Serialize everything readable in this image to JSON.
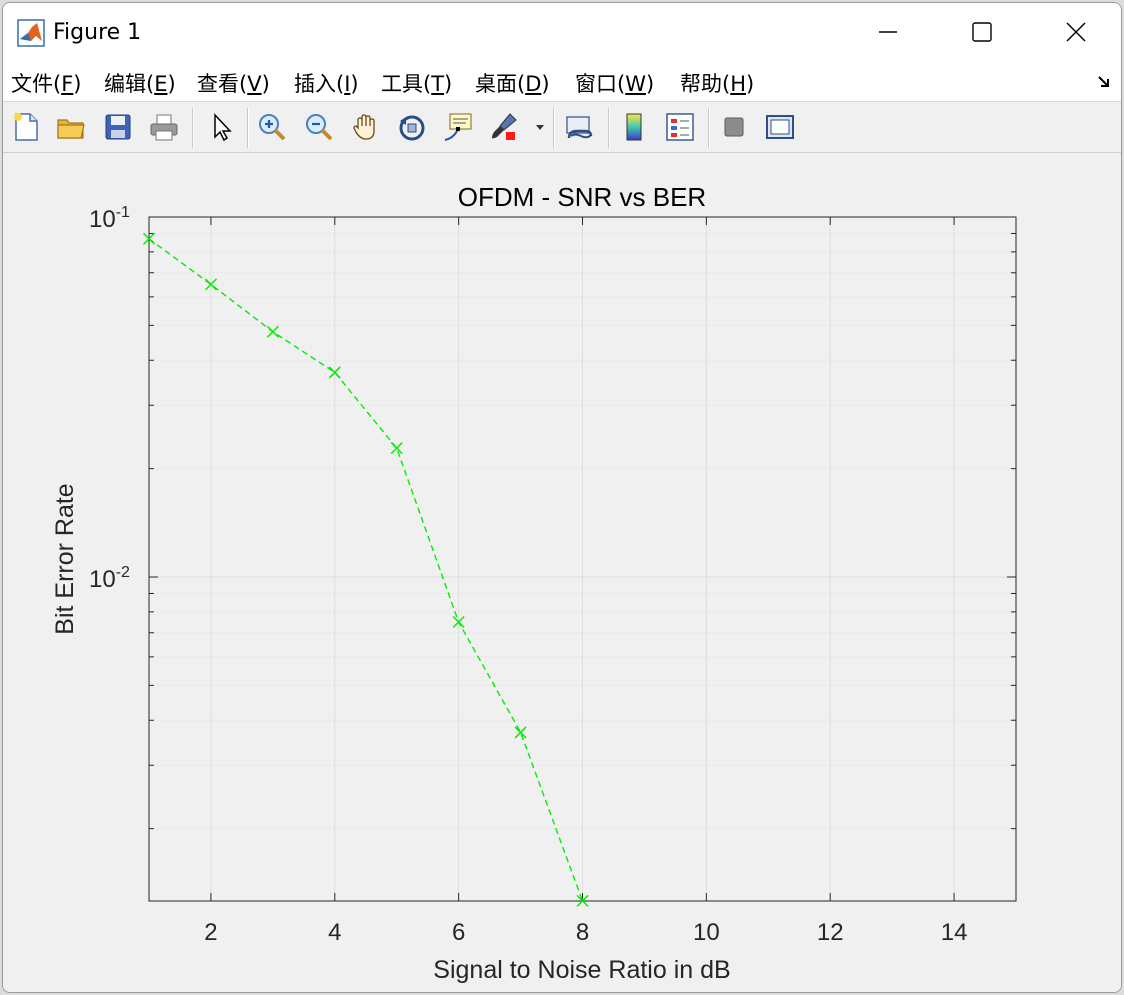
{
  "window": {
    "title": "Figure 1",
    "controls": [
      "minimize",
      "maximize",
      "close"
    ]
  },
  "menu": [
    {
      "label": "文件(",
      "key": "F",
      "tail": ")"
    },
    {
      "label": "编辑(",
      "key": "E",
      "tail": ")"
    },
    {
      "label": "查看(",
      "key": "V",
      "tail": ")"
    },
    {
      "label": "插入(",
      "key": "I",
      "tail": ")"
    },
    {
      "label": "工具(",
      "key": "T",
      "tail": ")"
    },
    {
      "label": "桌面(",
      "key": "D",
      "tail": ")"
    },
    {
      "label": "窗口(",
      "key": "W",
      "tail": ")"
    },
    {
      "label": "帮助(",
      "key": "H",
      "tail": ")"
    }
  ],
  "toolbar": [
    "new-figure",
    "open-file",
    "save",
    "print",
    "edit-plot",
    "zoom-in",
    "zoom-out",
    "pan",
    "rotate-3d",
    "data-cursor",
    "brush",
    "brush-dropdown",
    "link-plot",
    "colorbar",
    "legend",
    "hide-plot-tools",
    "show-plot-tools"
  ],
  "colors": {
    "series": "#00ee00",
    "grid": "#dcdcdc"
  },
  "chart_data": {
    "type": "line",
    "title": "OFDM - SNR vs BER",
    "xlabel": "Signal to Noise Ratio in dB",
    "ylabel": "Bit Error Rate",
    "xlim": [
      1,
      15
    ],
    "ylim_log10": [
      -2.9,
      -1.0
    ],
    "yscale": "log",
    "grid": true,
    "minor_grid": true,
    "xticks": [
      2,
      4,
      6,
      8,
      10,
      12,
      14
    ],
    "yticks": [
      {
        "base": "10",
        "exp": "-1",
        "value": 0.1
      },
      {
        "base": "10",
        "exp": "-2",
        "value": 0.01
      }
    ],
    "series": [
      {
        "line": "dashed",
        "marker": "x",
        "color": "#00ee00",
        "x": [
          1,
          2,
          3,
          4,
          5,
          6,
          7,
          8
        ],
        "y": [
          0.087,
          0.065,
          0.048,
          0.037,
          0.0228,
          0.0075,
          0.0037,
          0.00126
        ]
      }
    ]
  }
}
